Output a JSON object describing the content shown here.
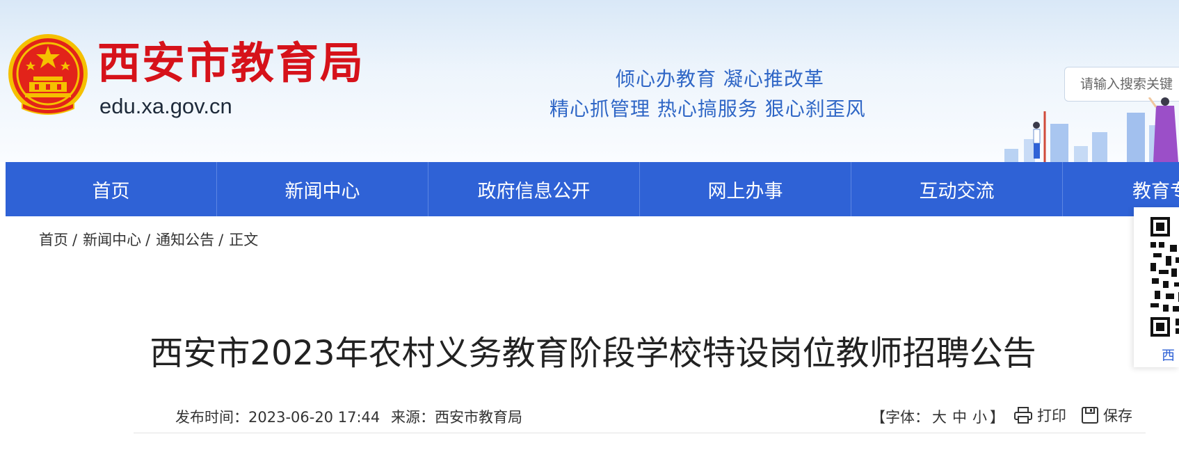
{
  "header": {
    "site_name": "西安市教育局",
    "domain": "edu.xa.gov.cn",
    "slogan_line1": "倾心办教育  凝心推改革",
    "slogan_line2": "精心抓管理  热心搞服务  狠心刹歪风",
    "search_placeholder": "请输入搜索关键"
  },
  "nav": {
    "items": [
      {
        "label": "首页"
      },
      {
        "label": "新闻中心"
      },
      {
        "label": "政府信息公开"
      },
      {
        "label": "网上办事"
      },
      {
        "label": "互动交流"
      },
      {
        "label": "教育专"
      }
    ]
  },
  "breadcrumb": {
    "items": [
      "首页",
      "新闻中心",
      "通知公告",
      "正文"
    ],
    "separator": "/"
  },
  "side_panel": {
    "qr_label": "西"
  },
  "article": {
    "title": "西安市2023年农村义务教育阶段学校特设岗位教师招聘公告",
    "publish_time": "发布时间：2023-06-20 17:44",
    "source": "来源：西安市教育局",
    "font_label_open": "【字体：",
    "font_large": "大",
    "font_medium": "中",
    "font_small": "小",
    "font_label_close": "】",
    "print_label": "打印",
    "save_label": "保存"
  },
  "colors": {
    "brand_red": "#d6121a",
    "nav_blue": "#2f62d6",
    "slogan_blue": "#2f66c6"
  }
}
